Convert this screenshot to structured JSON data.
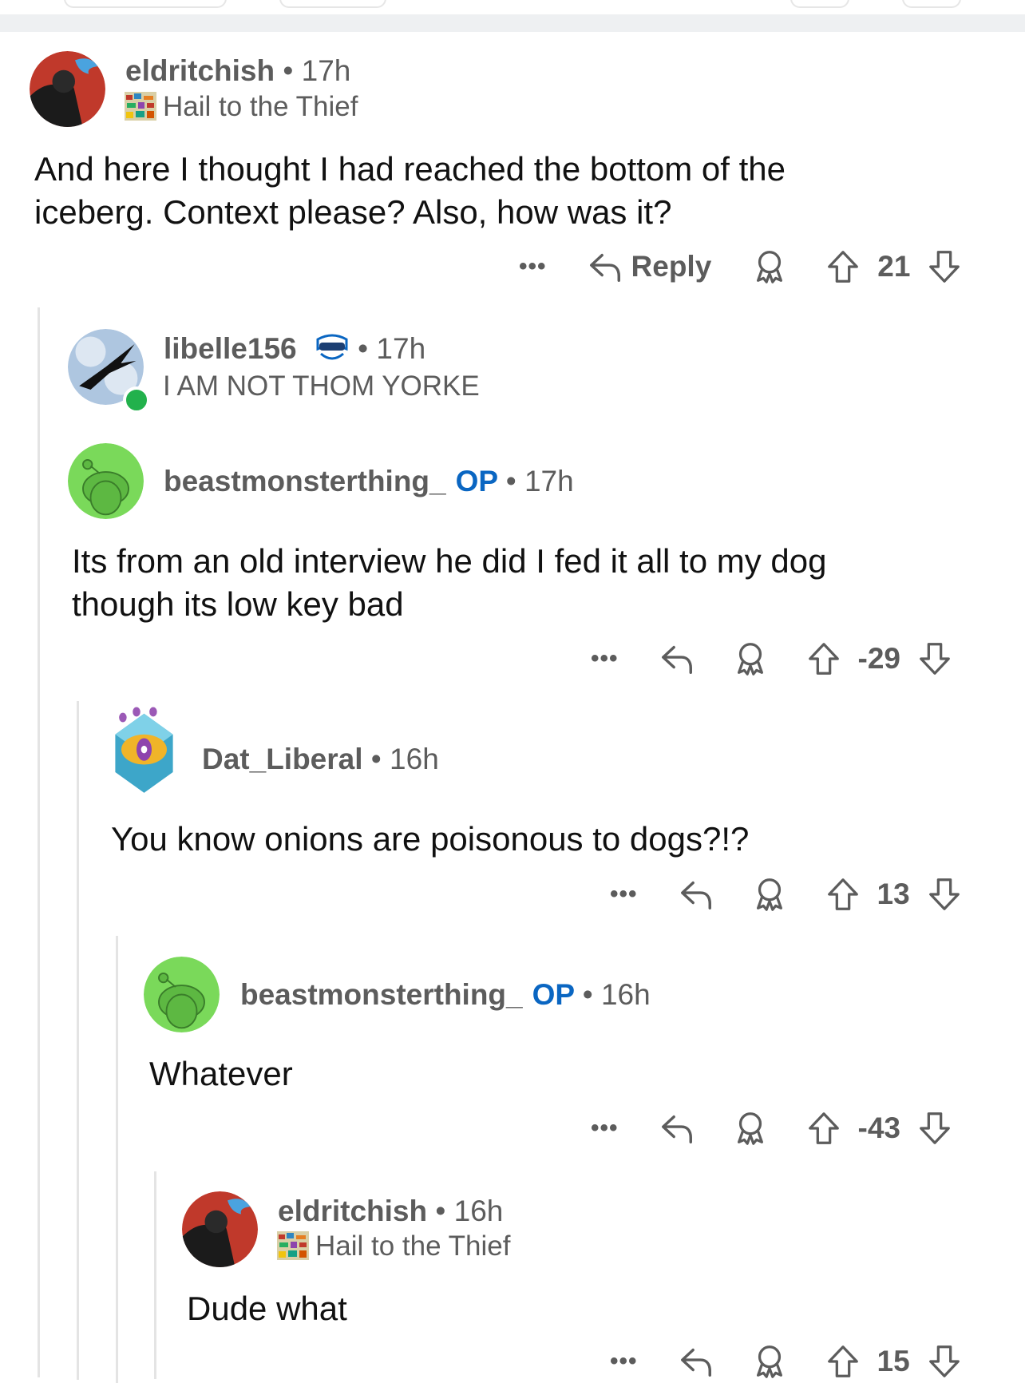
{
  "comments": [
    {
      "username": "eldritchish",
      "time": "17h",
      "flair": "Hail to the Thief",
      "body_lines": [
        "And here I thought I had reached the bottom of the",
        "iceberg. Context please? Also, how was it?"
      ],
      "reply_label": "Reply",
      "score": "21"
    },
    {
      "username": "libelle156",
      "time": "17h",
      "flair": "I AM NOT THOM YORKE"
    },
    {
      "username": "beastmonsterthing_",
      "op_badge": "OP",
      "time": "17h",
      "body_lines": [
        "Its from an old interview he did I fed it all to my dog",
        "though its low key bad"
      ],
      "score": "-29"
    },
    {
      "username": "Dat_Liberal",
      "time": "16h",
      "body_lines": [
        "You know onions are poisonous to dogs?!?"
      ],
      "score": "13"
    },
    {
      "username": "beastmonsterthing_",
      "op_badge": "OP",
      "time": "16h",
      "body_lines": [
        "Whatever"
      ],
      "score": "-43"
    },
    {
      "username": "eldritchish",
      "time": "16h",
      "flair": "Hail to the Thief",
      "body_lines": [
        "Dude what"
      ],
      "score": "15"
    }
  ],
  "separator": "•",
  "more_glyph": "•••",
  "icons": [
    "more-icon",
    "reply-icon",
    "award-icon",
    "upvote-icon",
    "downvote-icon",
    "flair-icon"
  ],
  "colors": {
    "op": "#0a66c2",
    "meta": "#5c5c5c",
    "online": "#22b14c",
    "snoo_bg": "#7ad95a"
  }
}
